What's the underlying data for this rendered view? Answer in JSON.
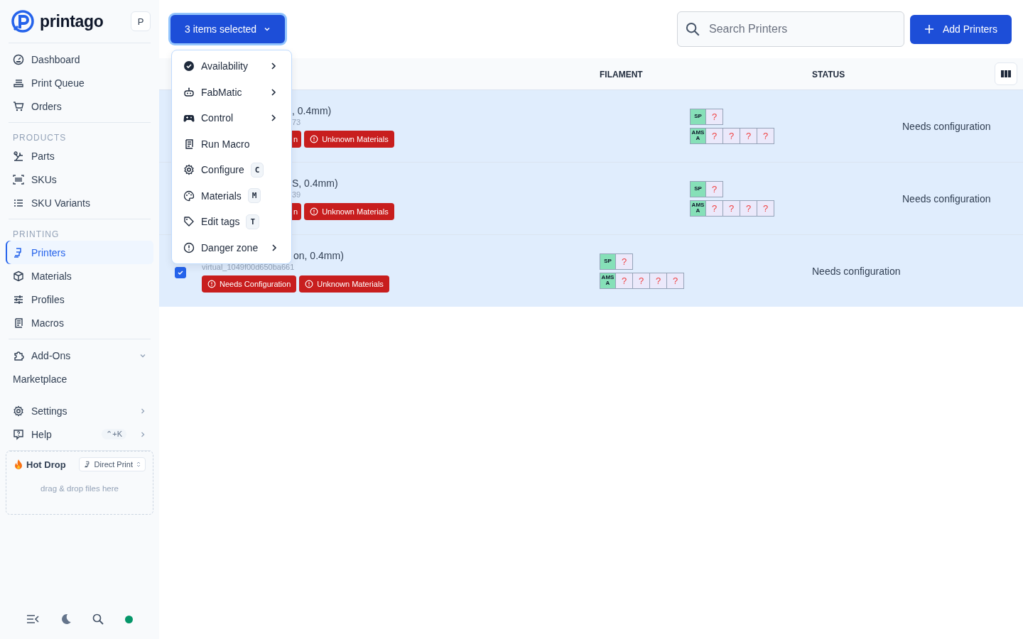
{
  "sidebar": {
    "logo": "printago",
    "avatar": "P",
    "sections": [
      {
        "items": [
          {
            "label": "Dashboard",
            "selected": false
          },
          {
            "label": "Print Queue",
            "selected": false
          },
          {
            "label": "Orders",
            "selected": false
          }
        ]
      },
      {
        "heading": "PRODUCTS",
        "items": [
          {
            "label": "Parts",
            "selected": false
          },
          {
            "label": "SKUs",
            "selected": false
          },
          {
            "label": "SKU Variants",
            "selected": false
          }
        ]
      },
      {
        "heading": "PRINTING",
        "items": [
          {
            "label": "Printers",
            "selected": true
          },
          {
            "label": "Materials",
            "selected": false
          },
          {
            "label": "Profiles",
            "selected": false
          },
          {
            "label": "Macros",
            "selected": false
          }
        ]
      },
      {
        "items": [
          {
            "label": "Add-Ons",
            "selected": false,
            "expanded": true
          },
          {
            "label": "Marketplace",
            "selected": false
          }
        ]
      },
      {
        "items": [
          {
            "label": "Settings",
            "selected": false,
            "expanded": false
          },
          {
            "label": "Help",
            "selected": false,
            "expanded": false,
            "shortcut": "⌃+K"
          }
        ]
      }
    ],
    "hot_drop": {
      "title": "Hot Drop",
      "mode": "Direct Print",
      "hint": "drag & drop files here"
    }
  },
  "toolbar": {
    "selection": "3 items selected",
    "search": {
      "placeholder": "Search Printers"
    },
    "add_button": "Add Printers"
  },
  "menu": [
    {
      "label": "Availability",
      "kind": "submenu"
    },
    {
      "label": "FabMatic",
      "kind": "submenu"
    },
    {
      "label": "Control",
      "kind": "submenu"
    },
    {
      "label": "Run Macro",
      "kind": "action"
    },
    {
      "label": "Configure",
      "kind": "shortcut",
      "key": "C"
    },
    {
      "label": "Materials",
      "kind": "shortcut",
      "key": "M"
    },
    {
      "label": "Edit tags",
      "kind": "shortcut",
      "key": "T"
    },
    {
      "label": "Danger zone",
      "kind": "submenu"
    }
  ],
  "table": {
    "columns": [
      "FILAMENT",
      "STATUS"
    ],
    "rows": [
      {
        "selected": true,
        "covered": true,
        "name": ", 0.4mm)",
        "subtitle": "73",
        "badges": [
          "n",
          "Unknown Materials"
        ],
        "filament": [
          {
            "unit": "SP",
            "slots": [
              "?"
            ]
          },
          {
            "unit": "AMS A",
            "slots": [
              "?",
              "?",
              "?",
              "?"
            ]
          }
        ],
        "status": "Needs configuration"
      },
      {
        "selected": true,
        "covered": true,
        "name": "S, 0.4mm)",
        "subtitle": "39",
        "badges": [
          "n",
          "Unknown Materials"
        ],
        "filament": [
          {
            "unit": "SP",
            "slots": [
              "?"
            ]
          },
          {
            "unit": "AMS A",
            "slots": [
              "?",
              "?",
              "?",
              "?"
            ]
          }
        ],
        "status": "Needs configuration"
      },
      {
        "selected": true,
        "covered": false,
        "checkbox": {
          "checked": true
        },
        "name": "on, 0.4mm)",
        "subtitle": "virtual_1049f00d650ba661",
        "badges": [
          "Needs Configuration",
          "Unknown Materials"
        ],
        "filament": [
          {
            "unit": "SP",
            "slots": [
              "?"
            ]
          },
          {
            "unit": "AMS A",
            "slots": [
              "?",
              "?",
              "?",
              "?"
            ]
          }
        ],
        "status": "Needs configuration"
      }
    ]
  }
}
